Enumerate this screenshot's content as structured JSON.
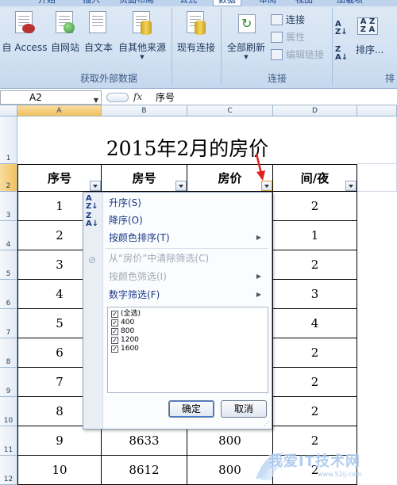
{
  "ribbon": {
    "tabs": [
      "开始",
      "插入",
      "页面布局",
      "公式",
      "数据",
      "审阅",
      "视图",
      "加载项"
    ],
    "active_tab": "数据",
    "get_external_data": {
      "label": "获取外部数据",
      "buttons": [
        "自 Access",
        "自网站",
        "自文本",
        "自其他来源"
      ]
    },
    "existing_connections": "现有连接",
    "connections": {
      "label": "连接",
      "refresh_all": "全部刷新",
      "items": [
        "连接",
        "属性",
        "编辑链接"
      ]
    },
    "sort_filter": {
      "label": "排",
      "sort": "排序..."
    }
  },
  "formula_bar": {
    "name_box": "A2",
    "fx": "fx",
    "content": "序号"
  },
  "grid": {
    "columns": [
      "A",
      "B",
      "C",
      "D"
    ],
    "rows": [
      "1",
      "2",
      "3",
      "4",
      "5",
      "6",
      "7",
      "8",
      "9",
      "10",
      "11",
      "12"
    ],
    "title": "2015年2月的房价",
    "headers": [
      "序号",
      "房号",
      "房价",
      "间/夜"
    ],
    "col_a": [
      "1",
      "2",
      "3",
      "4",
      "5",
      "6",
      "7",
      "8",
      "9",
      "10"
    ],
    "col_b_visible": [
      "8633",
      "8612"
    ],
    "col_c_visible": [
      "800",
      "800"
    ],
    "col_d": [
      "2",
      "1",
      "2",
      "3",
      "4",
      "2",
      "2",
      "2",
      "2",
      "2"
    ]
  },
  "filter_menu": {
    "sort_asc": "升序(S)",
    "sort_desc": "降序(O)",
    "sort_by_color": "按颜色排序(T)",
    "clear_filter": "从“房价”中清除筛选(C)",
    "filter_by_color": "按颜色筛选(I)",
    "number_filters": "数字筛选(F)",
    "values": [
      "(全选)",
      "400",
      "800",
      "1200",
      "1600"
    ],
    "ok": "确定",
    "cancel": "取消"
  },
  "watermark": {
    "text": "我爱IT技术网",
    "url": "www.52ij.com"
  },
  "colors": {
    "ribbon_bg": "#d3e2f3",
    "header_selected": "#f1c15f",
    "menu_text": "#1b3b87",
    "annotation_arrow": "#e0201c"
  }
}
